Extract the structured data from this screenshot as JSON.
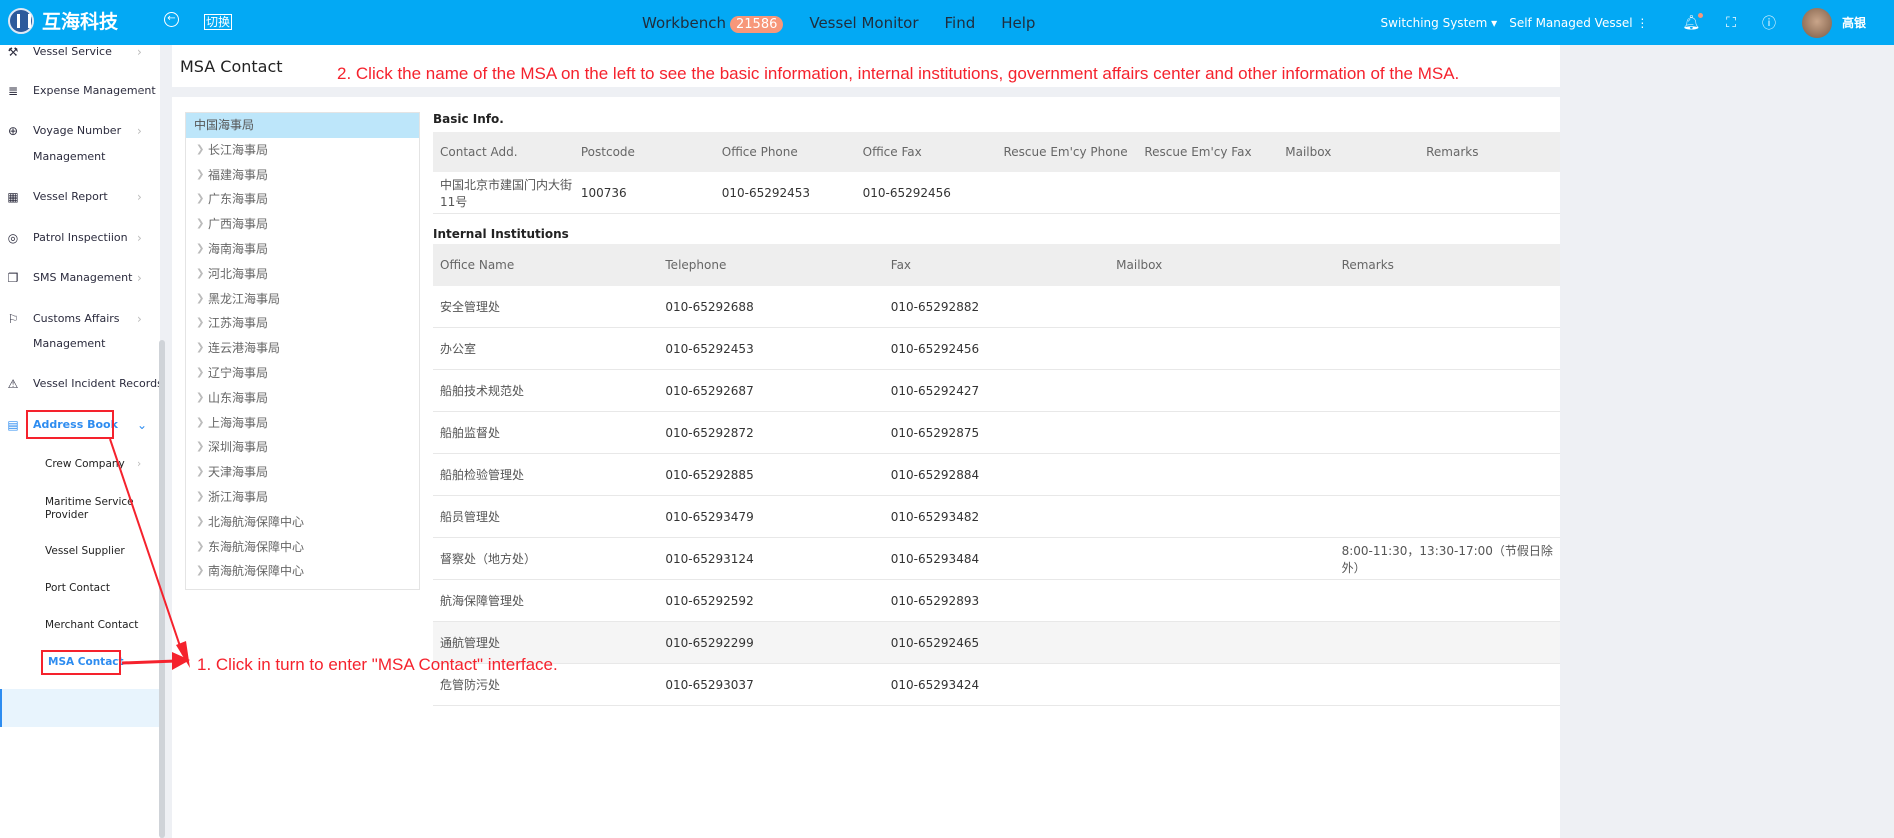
{
  "header": {
    "logo_text": "互海科技",
    "switch_label": "切换",
    "nav": [
      {
        "label": "Workbench",
        "badge": "21586"
      },
      {
        "label": "Vessel Monitor"
      },
      {
        "label": "Find"
      },
      {
        "label": "Help"
      }
    ],
    "switching_system": "Switching System",
    "self_managed": "Self Managed Vessel",
    "user": "高银",
    "brand_color": "#03a9f4",
    "badge_color": "#f7977a"
  },
  "sidebar": {
    "items": [
      {
        "label": "Vessel Service",
        "icon": "paint-roller-icon"
      },
      {
        "label": "Expense Management",
        "icon": "database-icon"
      },
      {
        "label": "Voyage Number",
        "label2": "Management",
        "icon": "globe-icon"
      },
      {
        "label": "Vessel Report",
        "icon": "calendar-icon"
      },
      {
        "label": "Patrol Inspectiion",
        "icon": "check-circle-icon"
      },
      {
        "label": "SMS Management",
        "icon": "documents-icon"
      },
      {
        "label": "Customs Affairs",
        "label2": "Management",
        "icon": "signpost-icon"
      },
      {
        "label": "Vessel Incident Records",
        "icon": "warning-icon"
      },
      {
        "label": "Address Book",
        "icon": "server-icon",
        "expanded": true
      }
    ],
    "sub_items": [
      {
        "label": "Crew Company"
      },
      {
        "label": "Maritime Service Provider"
      },
      {
        "label": "Vessel Supplier"
      },
      {
        "label": "Port Contact"
      },
      {
        "label": "Merchant Contact"
      },
      {
        "label": "MSA Contact",
        "active": true
      }
    ]
  },
  "page": {
    "title": "MSA Contact"
  },
  "annotations": {
    "step1": "1. Click in turn to enter \"MSA Contact\" interface.",
    "step2": "2. Click the name of the MSA on the left to see the basic information, internal institutions, government affairs center and other information of the MSA.",
    "color": "#f5222d"
  },
  "tree": [
    "中国海事局",
    "长江海事局",
    "福建海事局",
    "广东海事局",
    "广西海事局",
    "海南海事局",
    "河北海事局",
    "黑龙江海事局",
    "江苏海事局",
    "连云港海事局",
    "辽宁海事局",
    "山东海事局",
    "上海海事局",
    "深圳海事局",
    "天津海事局",
    "浙江海事局",
    "北海航海保障中心",
    "东海航海保障中心",
    "南海航海保障中心"
  ],
  "basic": {
    "title": "Basic Info.",
    "columns": [
      "Contact Add.",
      "Postcode",
      "Office Phone",
      "Office Fax",
      "Rescue Em'cy Phone",
      "Rescue Em'cy Fax",
      "Mailbox",
      "Remarks"
    ],
    "row": [
      "中国北京市建国门内大街11号",
      "100736",
      "010-65292453",
      "010-65292456",
      "",
      "",
      "",
      ""
    ]
  },
  "internal": {
    "title": "Internal Institutions",
    "columns": [
      "Office Name",
      "Telephone",
      "Fax",
      "Mailbox",
      "Remarks"
    ],
    "rows": [
      [
        "安全管理处",
        "010-65292688",
        "010-65292882",
        "",
        ""
      ],
      [
        "办公室",
        "010-65292453",
        "010-65292456",
        "",
        ""
      ],
      [
        "船舶技术规范处",
        "010-65292687",
        "010-65292427",
        "",
        ""
      ],
      [
        "船舶监督处",
        "010-65292872",
        "010-65292875",
        "",
        ""
      ],
      [
        "船舶检验管理处",
        "010-65292885",
        "010-65292884",
        "",
        ""
      ],
      [
        "船员管理处",
        "010-65293479",
        "010-65293482",
        "",
        ""
      ],
      [
        "督察处（地方处）",
        "010-65293124",
        "010-65293484",
        "",
        "8:00-11:30，13:30-17:00（节假日除外）"
      ],
      [
        "航海保障管理处",
        "010-65292592",
        "010-65292893",
        "",
        ""
      ],
      [
        "通航管理处",
        "010-65292299",
        "010-65292465",
        "",
        ""
      ],
      [
        "危管防污处",
        "010-65293037",
        "010-65293424",
        "",
        ""
      ]
    ]
  }
}
